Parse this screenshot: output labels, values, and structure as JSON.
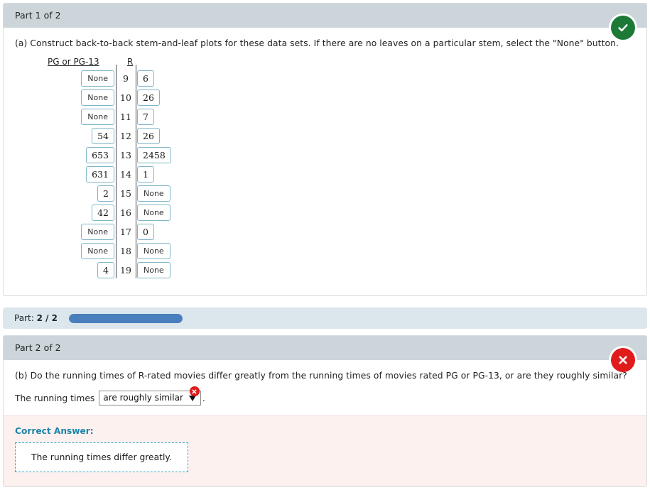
{
  "theme": {
    "header_bg": "#ccd5da",
    "progress_band_bg": "#dce6ed",
    "progress_fill": "#4a7fbd",
    "correct_bg": "#fdf1f0",
    "correct_title_color": "#1b84a8",
    "ok_green": "#1c7a36",
    "error_red": "#e01b1b",
    "leafbox_border": "#7fb6c8"
  },
  "part1": {
    "header": "Part 1 of 2",
    "status": "correct",
    "question": "(a) Construct back-to-back stem-and-leaf plots for these data sets. If there are no leaves on a particular stem, select the \"None\" button.",
    "plot": {
      "left_heading": "PG or PG-13",
      "right_heading": "R",
      "none_label": "None",
      "rows": [
        {
          "stem": "9",
          "left": "None",
          "right": "6"
        },
        {
          "stem": "10",
          "left": "None",
          "right": "26"
        },
        {
          "stem": "11",
          "left": "None",
          "right": "7"
        },
        {
          "stem": "12",
          "left": "54",
          "right": "26"
        },
        {
          "stem": "13",
          "left": "653",
          "right": "2458"
        },
        {
          "stem": "14",
          "left": "631",
          "right": "1"
        },
        {
          "stem": "15",
          "left": "2",
          "right": "None"
        },
        {
          "stem": "16",
          "left": "42",
          "right": "None"
        },
        {
          "stem": "17",
          "left": "None",
          "right": "0"
        },
        {
          "stem": "18",
          "left": "None",
          "right": "None"
        },
        {
          "stem": "19",
          "left": "4",
          "right": "None"
        }
      ]
    }
  },
  "progress": {
    "label_prefix": "Part:",
    "label_value": "2 / 2",
    "current": 2,
    "total": 2,
    "percent": 100
  },
  "part2": {
    "header": "Part 2 of 2",
    "status": "incorrect",
    "question": "(b) Do the running times of R-rated movies differ greatly from the running times of movies rated PG or PG-13, or are they roughly similar?",
    "answer_prefix": "The running times",
    "answer_suffix": ".",
    "dropdown_value": "are roughly similar",
    "correct_answer_title": "Correct Answer:",
    "correct_answer_text": "The running times differ greatly."
  }
}
